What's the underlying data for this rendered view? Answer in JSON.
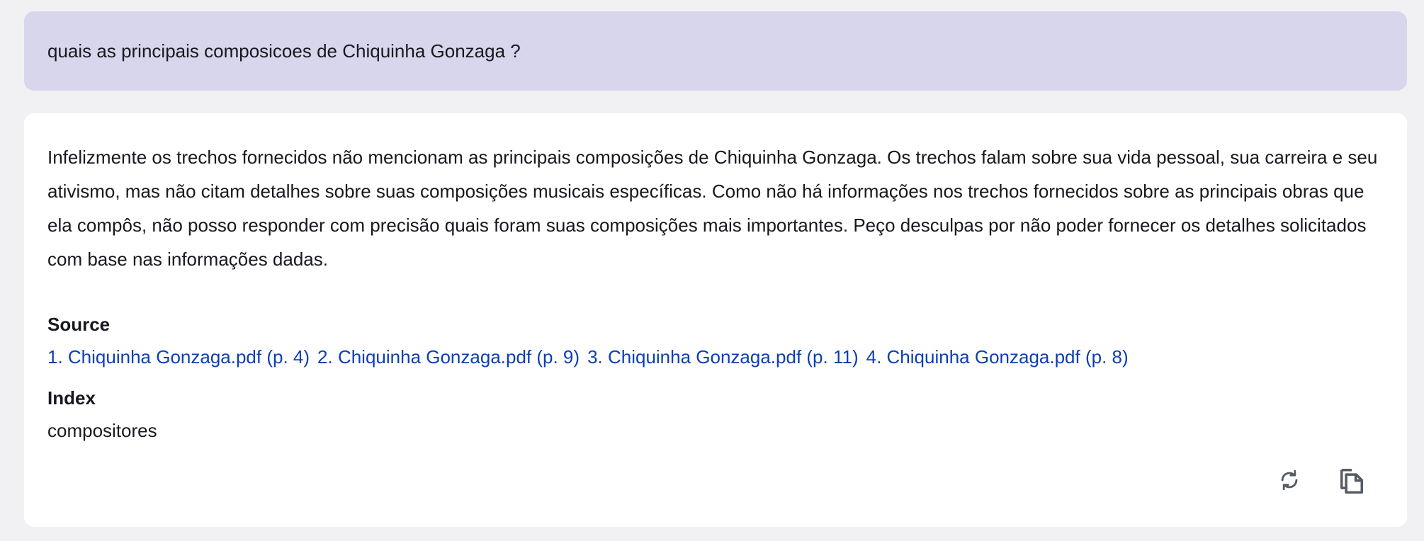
{
  "prompt": {
    "text": "quais as principais composicoes de Chiquinha Gonzaga ?"
  },
  "answer": {
    "text": "Infelizmente os trechos fornecidos não mencionam as principais composições de Chiquinha Gonzaga. Os trechos falam sobre sua vida pessoal, sua carreira e seu ativismo, mas não citam detalhes sobre suas composições musicais específicas. Como não há informações nos trechos fornecidos sobre as principais obras que ela compôs, não posso responder com precisão quais foram suas composições mais importantes. Peço desculpas por não poder fornecer os detalhes solicitados com base nas informações dadas."
  },
  "source": {
    "title": "Source",
    "links": [
      "1. Chiquinha Gonzaga.pdf (p. 4)",
      "2. Chiquinha Gonzaga.pdf (p. 9)",
      "3. Chiquinha Gonzaga.pdf (p. 11)",
      "4. Chiquinha Gonzaga.pdf (p. 8)"
    ]
  },
  "index": {
    "title": "Index",
    "value": "compositores"
  },
  "actions": {
    "regenerate_icon": "refresh-icon",
    "copy_icon": "copy-icon"
  },
  "colors": {
    "prompt_background": "#d8d6ec",
    "page_background": "#f1f1f3",
    "card_background": "#ffffff",
    "link": "#0b3fb3",
    "icon": "#545b64"
  }
}
